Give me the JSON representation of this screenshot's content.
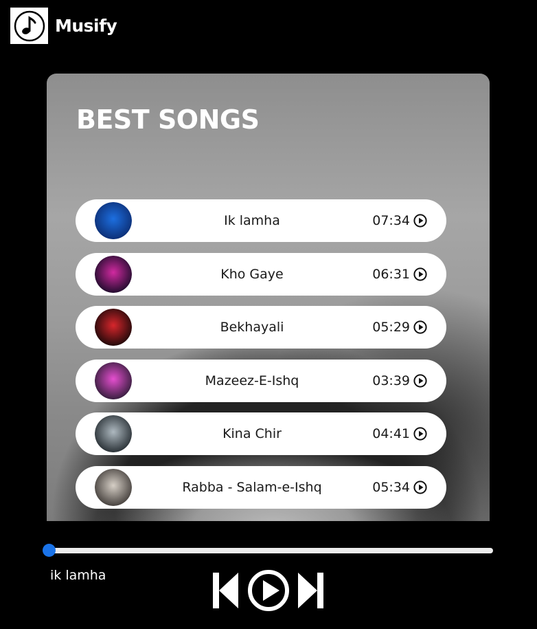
{
  "header": {
    "brand": "Musify",
    "logo_icon": "music-note-icon"
  },
  "card": {
    "title": "BEST SONGS"
  },
  "songs": [
    {
      "title": "Ik lamha",
      "duration": "07:34",
      "art_colors": [
        "#0b2a6e",
        "#1d6fe0"
      ]
    },
    {
      "title": "Kho Gaye",
      "duration": "06:31",
      "art_colors": [
        "#150a26",
        "#d12aa0"
      ]
    },
    {
      "title": "Bekhayali",
      "duration": "05:29",
      "art_colors": [
        "#140707",
        "#d7262c"
      ]
    },
    {
      "title": "Mazeez-E-Ishq",
      "duration": "03:39",
      "art_colors": [
        "#2a1a33",
        "#e64fd0"
      ]
    },
    {
      "title": "Kina Chir",
      "duration": "04:41",
      "art_colors": [
        "#20272c",
        "#aeb9c0"
      ]
    },
    {
      "title": "Rabba - Salam-e-Ishq",
      "duration": "05:34",
      "art_colors": [
        "#3b3633",
        "#d6cfc6"
      ]
    }
  ],
  "player": {
    "now_playing": "ik lamha",
    "progress": 0,
    "accent": "#1a73e8"
  }
}
